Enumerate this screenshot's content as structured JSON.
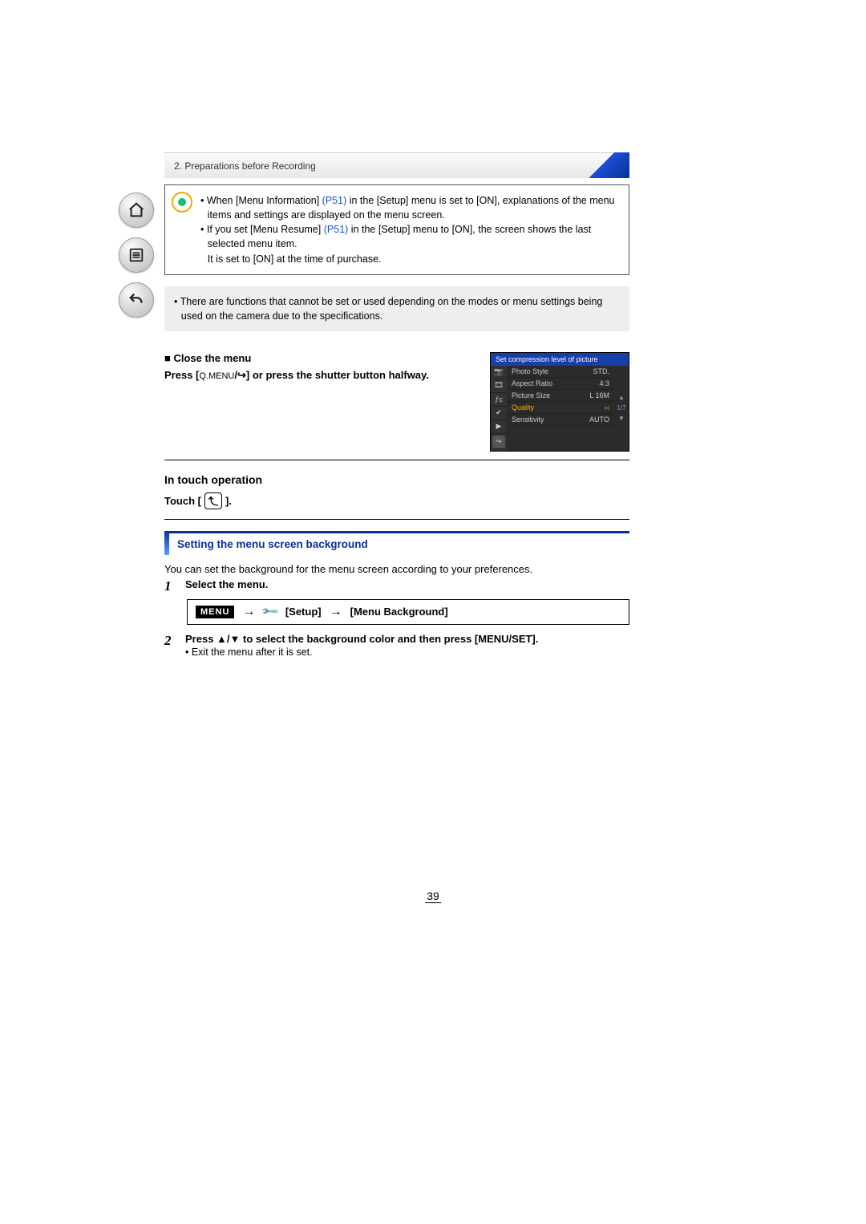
{
  "chapter": "2. Preparations before Recording",
  "info": {
    "l1a": "• When [Menu Information] ",
    "l1link": "(P51)",
    "l1b": " in the [Setup] menu is set to [ON], explanations of the menu items and settings are displayed on the menu screen.",
    "l2a": "• If you set [Menu Resume] ",
    "l2link": "(P51)",
    "l2b": " in the [Setup] menu to [ON], the screen shows the last selected menu item.",
    "l3": "It is set to [ON] at the time of purchase."
  },
  "note": "• There are functions that cannot be set or used depending on the modes or menu settings being used on the camera due to the specifications.",
  "close": {
    "heading": "Close the menu",
    "press_a": "Press [",
    "press_q": "Q.MENU",
    "press_b": "] or press the shutter button halfway."
  },
  "camera_menu": {
    "title": "Set compression level of picture",
    "rows": [
      {
        "label": "Photo Style",
        "val": "STD."
      },
      {
        "label": "Aspect Ratio",
        "val": "4:3"
      },
      {
        "label": "Picture Size",
        "val": "L 16M"
      },
      {
        "label": "Quality",
        "val": "›‹",
        "hl": true
      },
      {
        "label": "Sensitivity",
        "val": "AUTO"
      }
    ],
    "page": "1/7"
  },
  "touch": {
    "heading": "In touch operation",
    "label": "Touch ["
  },
  "section": "Setting the menu screen background",
  "intro": "You can set the background for the menu screen according to your preferences.",
  "steps": {
    "s1": "Select the menu.",
    "menu_label": "MENU",
    "path_setup": "[Setup]",
    "path_item": "[Menu Background]",
    "s2": "Press ▲/▼ to select the background color and then press [MENU/SET].",
    "s2sub": "• Exit the menu after it is set."
  },
  "page_number": "39"
}
